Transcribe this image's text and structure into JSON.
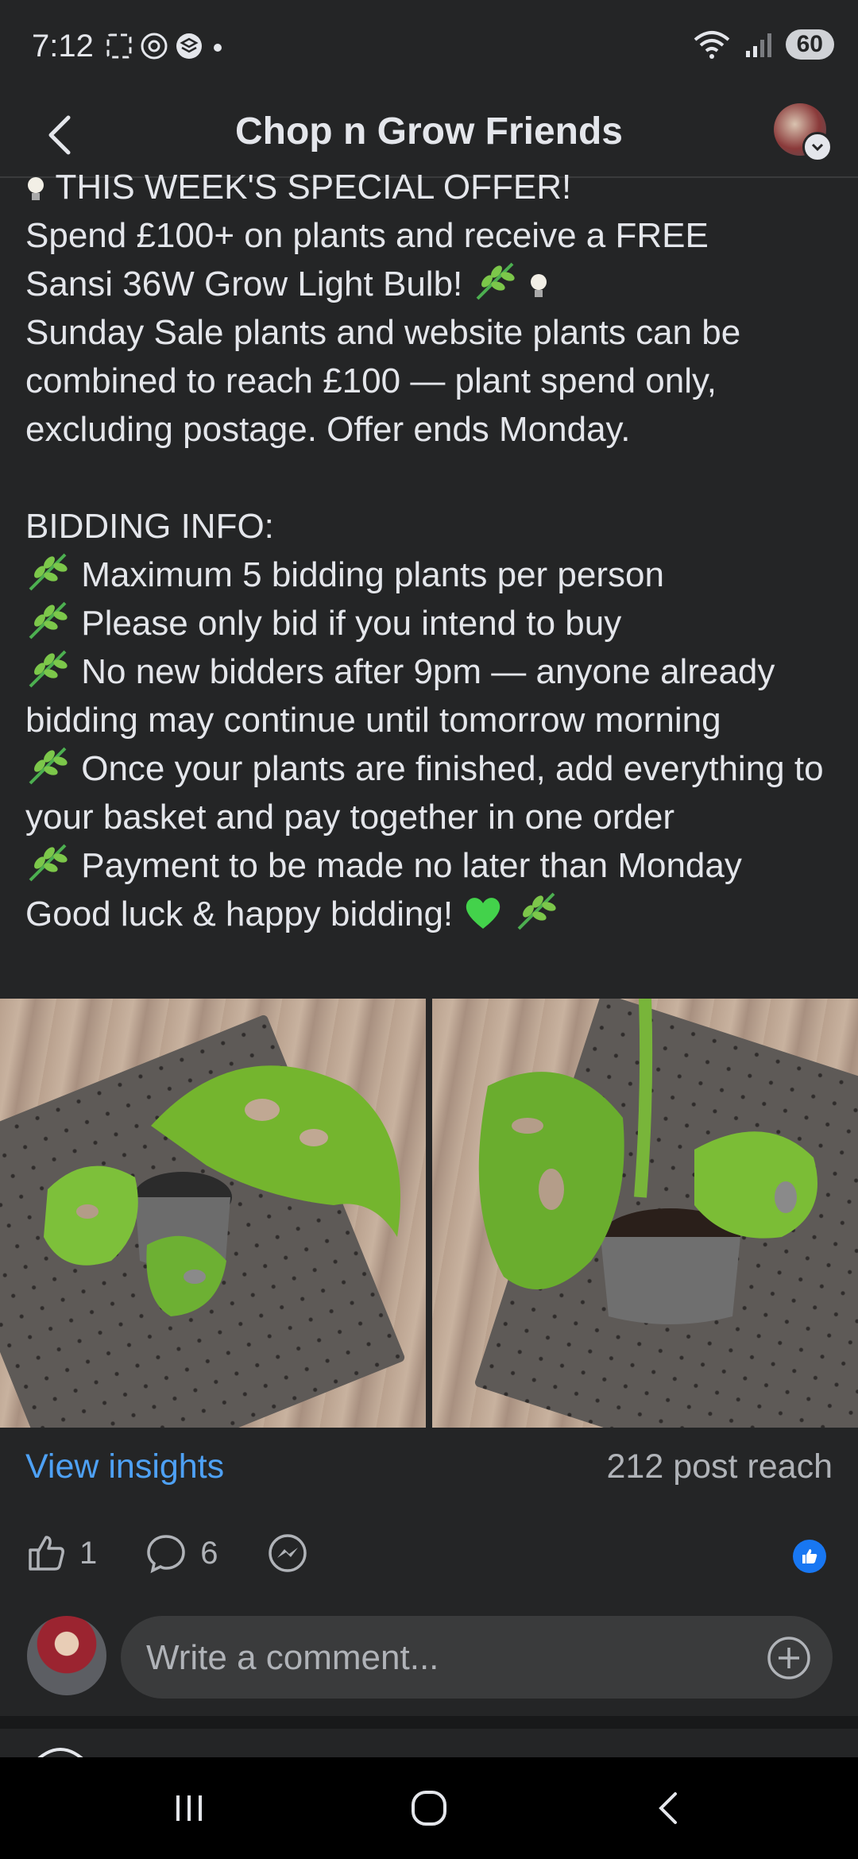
{
  "status_bar": {
    "time": "7:12",
    "battery": "60"
  },
  "header": {
    "title": "Chop n Grow Friends"
  },
  "post": {
    "offer_heading": "THIS WEEK'S SPECIAL OFFER!",
    "offer_line1": "Spend £100+ on plants and receive a FREE",
    "offer_line2": "Sansi 36W Grow Light Bulb!",
    "offer_body": "Sunday Sale plants and website plants can be combined to reach £100 — plant spend only, excluding postage. Offer ends Monday.",
    "bidding_heading": "BIDDING INFO:",
    "rules": [
      "Maximum 5 bidding plants per person",
      "Please only bid if you intend to buy",
      "No new bidders after 9pm — anyone already bidding may continue until tomorrow morning",
      "Once your plants are finished, add everything to your basket and pay together in one order",
      "Payment to be made no later than Monday"
    ],
    "signoff": "Good luck & happy bidding!"
  },
  "insights": {
    "link": "View insights",
    "reach": "212 post reach"
  },
  "actions": {
    "likes": "1",
    "comments": "6"
  },
  "comment_box": {
    "placeholder": "Write a comment..."
  },
  "icons": {
    "back": "chevron-left-icon",
    "like": "thumbs-up-icon",
    "comment": "speech-bubble-icon",
    "messenger": "messenger-icon",
    "add": "plus-circle-icon"
  },
  "colors": {
    "background": "#242526",
    "link": "#4ea1f5",
    "like_badge": "#1877f2"
  }
}
